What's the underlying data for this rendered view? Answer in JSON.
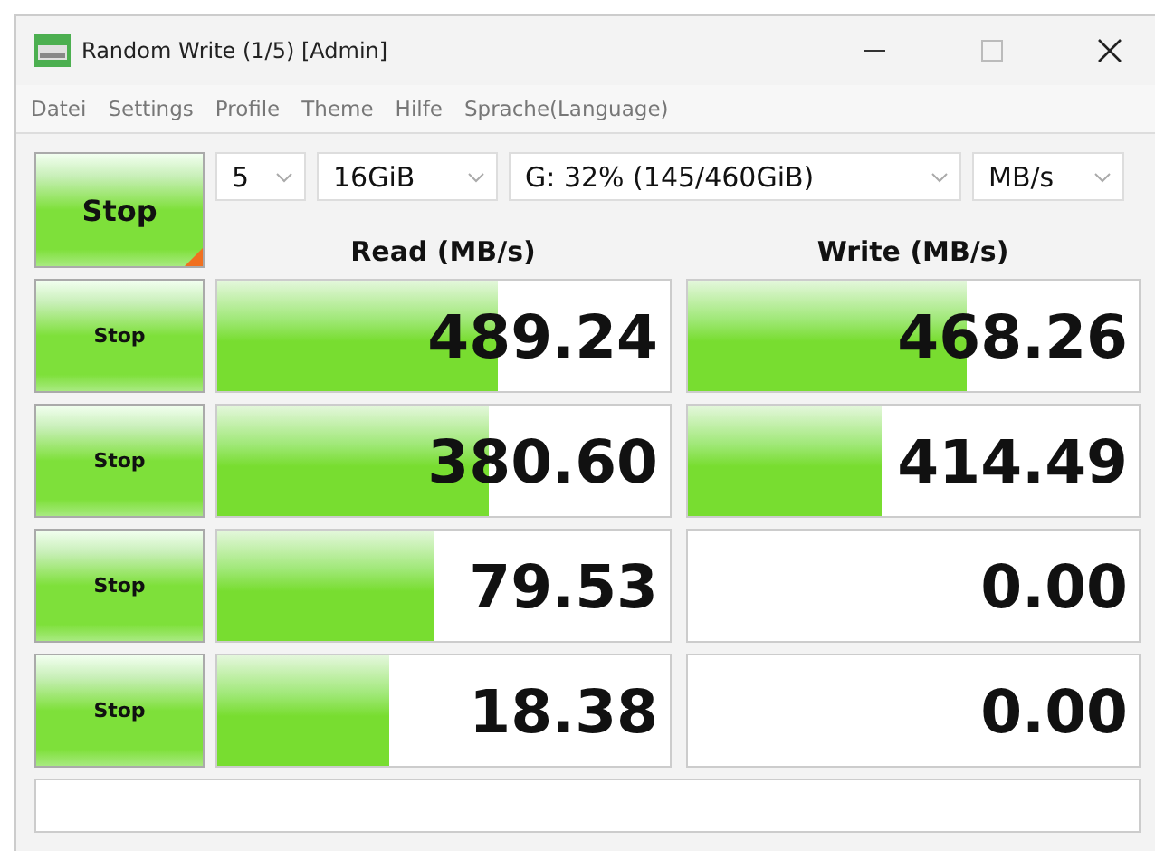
{
  "window": {
    "title": "Random Write (1/5) [Admin]"
  },
  "menu": [
    "Datei",
    "Settings",
    "Profile",
    "Theme",
    "Hilfe",
    "Sprache(Language)"
  ],
  "main_button": {
    "label": "Stop"
  },
  "selects": [
    {
      "value": "5"
    },
    {
      "value": "16GiB"
    },
    {
      "value": "G: 32% (145/460GiB)"
    },
    {
      "value": "MB/s"
    }
  ],
  "headers": {
    "read": "Read (MB/s)",
    "write": "Write (MB/s)"
  },
  "rows": [
    {
      "button": "Stop",
      "read": {
        "value": "489.24",
        "level": 0.62
      },
      "write": {
        "value": "468.26",
        "level": 0.62
      }
    },
    {
      "button": "Stop",
      "read": {
        "value": "380.60",
        "level": 0.6
      },
      "write": {
        "value": "414.49",
        "level": 0.43
      }
    },
    {
      "button": "Stop",
      "read": {
        "value": "79.53",
        "level": 0.48
      },
      "write": {
        "value": "0.00"
      }
    },
    {
      "button": "Stop",
      "read": {
        "value": "18.38",
        "level": 0.38
      },
      "write": {
        "value": "0.00"
      }
    }
  ]
}
